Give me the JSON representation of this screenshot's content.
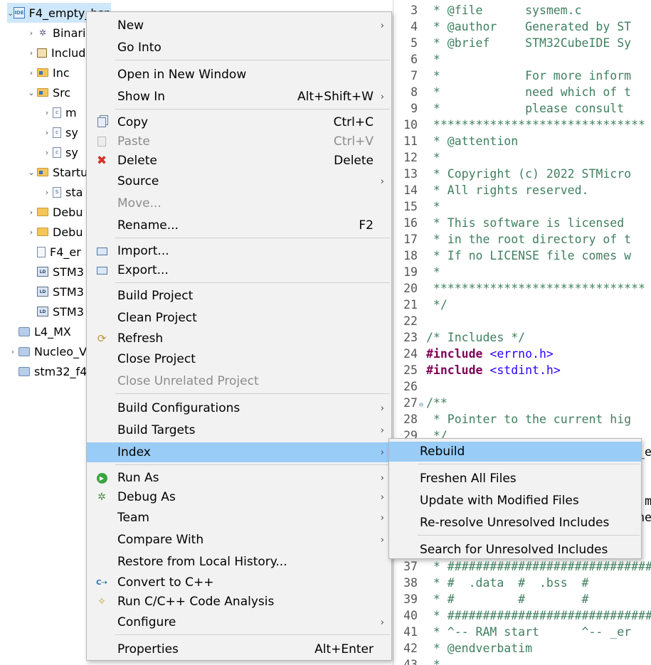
{
  "tree": {
    "items": [
      {
        "label": "F4_empty_bsp",
        "arrow": "⌄",
        "icon": "ide-project-icon",
        "badge": "IDE",
        "selected": true
      },
      {
        "label": "Binari",
        "arrow": "›",
        "icon": "binaries-icon"
      },
      {
        "label": "Includ",
        "arrow": "›",
        "icon": "includes-icon"
      },
      {
        "label": "Inc",
        "arrow": "›",
        "icon": "source-folder-icon"
      },
      {
        "label": "Src",
        "arrow": "⌄",
        "icon": "source-folder-icon"
      },
      {
        "label": "m",
        "arrow": "›",
        "icon": "c-file-icon",
        "badge": "c"
      },
      {
        "label": "sy",
        "arrow": "›",
        "icon": "c-file-icon",
        "badge": "c"
      },
      {
        "label": "sy",
        "arrow": "›",
        "icon": "c-file-icon",
        "badge": "c"
      },
      {
        "label": "Startu",
        "arrow": "⌄",
        "icon": "source-folder-icon"
      },
      {
        "label": "sta",
        "arrow": "›",
        "icon": "asm-file-icon",
        "badge": "S"
      },
      {
        "label": "Debu",
        "arrow": "›",
        "icon": "folder-icon"
      },
      {
        "label": "Debu",
        "arrow": "›",
        "icon": "folder-icon"
      },
      {
        "label": "F4_er",
        "arrow": "",
        "icon": "file-icon"
      },
      {
        "label": "STM3",
        "arrow": "",
        "icon": "linker-file-icon",
        "badge": "LD"
      },
      {
        "label": "STM3",
        "arrow": "",
        "icon": "linker-file-icon",
        "badge": "LD"
      },
      {
        "label": "STM3",
        "arrow": "",
        "icon": "linker-file-icon",
        "badge": "LD"
      },
      {
        "label": "L4_MX",
        "arrow": "",
        "icon": "project-icon"
      },
      {
        "label": "Nucleo_V",
        "arrow": "›",
        "icon": "project-icon"
      },
      {
        "label": "stm32_f4",
        "arrow": "",
        "icon": "project-icon"
      }
    ]
  },
  "editor": {
    "lines": [
      {
        "n": "3",
        "text": " * @file      sysmem.c"
      },
      {
        "n": "4",
        "text": " * @author    Generated by ST"
      },
      {
        "n": "5",
        "text": " * @brief     STM32CubeIDE Sy"
      },
      {
        "n": "6",
        "text": " *"
      },
      {
        "n": "7",
        "text": " *            For more inform"
      },
      {
        "n": "8",
        "text": " *            need which of t"
      },
      {
        "n": "9",
        "text": " *            please consult "
      },
      {
        "n": "10",
        "text": " ******************************"
      },
      {
        "n": "11",
        "text": " * @attention"
      },
      {
        "n": "12",
        "text": " *"
      },
      {
        "n": "13",
        "text": " * Copyright (c) 2022 STMicro"
      },
      {
        "n": "14",
        "text": " * All rights reserved."
      },
      {
        "n": "15",
        "text": " *"
      },
      {
        "n": "16",
        "text": " * This software is licensed "
      },
      {
        "n": "17",
        "text": " * in the root directory of t"
      },
      {
        "n": "18",
        "text": " * If no LICENSE file comes w"
      },
      {
        "n": "19",
        "text": " *"
      },
      {
        "n": "20",
        "text": " ******************************"
      },
      {
        "n": "21",
        "text": " */"
      },
      {
        "n": "22",
        "text": ""
      },
      {
        "n": "23",
        "text": "/* Includes */"
      },
      {
        "n": "24",
        "text": "#include",
        "inc": " <errno.h>",
        "kind": "directive"
      },
      {
        "n": "25",
        "text": "#include",
        "inc": " <stdint.h>",
        "kind": "directive"
      },
      {
        "n": "26",
        "text": ""
      },
      {
        "n": "27",
        "text": "/**",
        "fold": "⊖"
      },
      {
        "n": "28",
        "text": " * Pointer to the current hig"
      },
      {
        "n": "29",
        "text": " */"
      },
      {
        "n": "",
        "text": "_e",
        "kind": "plain"
      },
      {
        "n": "",
        "text": ""
      },
      {
        "n": "",
        "text": ""
      },
      {
        "n": "",
        "text": "m",
        "kind": "plain"
      },
      {
        "n": "",
        "text": "he",
        "kind": "plain"
      },
      {
        "n": "",
        "text": ""
      },
      {
        "n": "",
        "text": ""
      },
      {
        "n": "37",
        "text": " * #############################"
      },
      {
        "n": "38",
        "text": " * #  .data  #  .bss  #"
      },
      {
        "n": "39",
        "text": " * #         #        #"
      },
      {
        "n": "40",
        "text": " * #############################"
      },
      {
        "n": "41",
        "text": " * ^-- RAM start      ^-- _er"
      },
      {
        "n": "42",
        "text": " * @endverbatim"
      },
      {
        "n": "43",
        "text": " *"
      }
    ]
  },
  "context_menu": {
    "items": [
      {
        "label": "New",
        "submenu": "›"
      },
      {
        "label": "Go Into"
      },
      {
        "sep": true
      },
      {
        "label": "Open in New Window"
      },
      {
        "label": "Show In",
        "shortcut": "Alt+Shift+W",
        "submenu": "›"
      },
      {
        "sep": true
      },
      {
        "label": "Copy",
        "shortcut": "Ctrl+C",
        "icon": "copy-icon"
      },
      {
        "label": "Paste",
        "shortcut": "Ctrl+V",
        "icon": "paste-icon",
        "disabled": true
      },
      {
        "label": "Delete",
        "shortcut": "Delete",
        "icon": "delete-icon"
      },
      {
        "label": "Source",
        "submenu": "›"
      },
      {
        "label": "Move...",
        "disabled": true
      },
      {
        "label": "Rename...",
        "shortcut": "F2"
      },
      {
        "sep": true
      },
      {
        "label": "Import...",
        "icon": "import-icon"
      },
      {
        "label": "Export...",
        "icon": "export-icon"
      },
      {
        "sep": true
      },
      {
        "label": "Build Project"
      },
      {
        "label": "Clean Project"
      },
      {
        "label": "Refresh",
        "icon": "refresh-icon"
      },
      {
        "label": "Close Project"
      },
      {
        "label": "Close Unrelated Project",
        "disabled": true
      },
      {
        "sep": true
      },
      {
        "label": "Build Configurations",
        "submenu": "›"
      },
      {
        "label": "Build Targets",
        "submenu": "›"
      },
      {
        "label": "Index",
        "submenu": "›",
        "highlighted": true
      },
      {
        "sep": true
      },
      {
        "label": "Run As",
        "submenu": "›",
        "icon": "run-icon"
      },
      {
        "label": "Debug As",
        "submenu": "›",
        "icon": "debug-icon"
      },
      {
        "label": "Team",
        "submenu": "›"
      },
      {
        "label": "Compare With",
        "submenu": "›"
      },
      {
        "label": "Restore from Local History..."
      },
      {
        "label": "Convert to C++",
        "icon": "convert-icon"
      },
      {
        "label": "Run C/C++ Code Analysis",
        "icon": "analysis-icon"
      },
      {
        "label": "Configure",
        "submenu": "›"
      },
      {
        "sep": true
      },
      {
        "label": "Properties",
        "shortcut": "Alt+Enter"
      }
    ]
  },
  "index_submenu": {
    "items": [
      {
        "label": "Rebuild",
        "highlighted": true
      },
      {
        "sep": true
      },
      {
        "label": "Freshen All Files"
      },
      {
        "label": "Update with Modified Files"
      },
      {
        "label": "Re-resolve Unresolved Includes"
      },
      {
        "sep": true
      },
      {
        "label": "Search for Unresolved Includes"
      }
    ]
  },
  "colors": {
    "menu_bg": "#f2f2f2",
    "menu_highlight": "#99ccf7",
    "tree_selected": "#cfe7fa",
    "comment": "#3f7f5f",
    "keyword": "#7f0055",
    "string": "#2a00ff"
  }
}
